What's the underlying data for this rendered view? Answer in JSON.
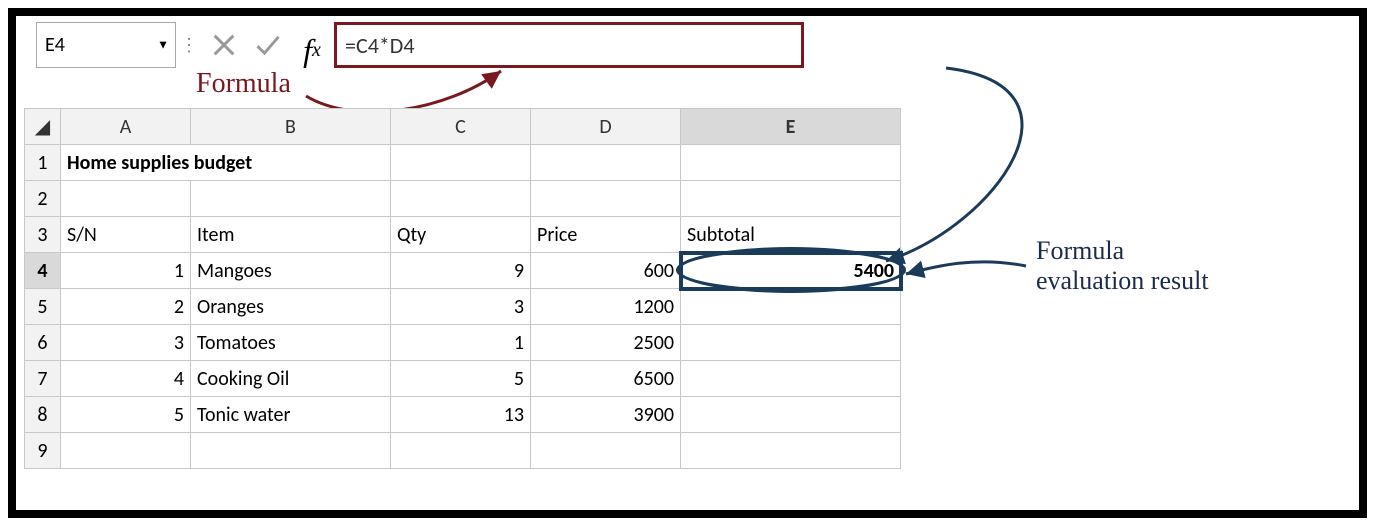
{
  "nameBox": "E4",
  "formula": "=C4*D4",
  "annotations": {
    "formula_label": "Formula",
    "result_label": "Formula\nevaluation result"
  },
  "columns": [
    "A",
    "B",
    "C",
    "D",
    "E"
  ],
  "row_numbers": [
    "1",
    "2",
    "3",
    "4",
    "5",
    "6",
    "7",
    "8",
    "9"
  ],
  "selected": {
    "col": "E",
    "row": "4"
  },
  "sheet": {
    "title": "Home supplies budget",
    "headers": {
      "sn": "S/N",
      "item": "Item",
      "qty": "Qty",
      "price": "Price",
      "subtotal": "Subtotal"
    },
    "rows": [
      {
        "sn": "1",
        "item": "Mangoes",
        "qty": "9",
        "price": "600",
        "subtotal": "5400"
      },
      {
        "sn": "2",
        "item": "Oranges",
        "qty": "3",
        "price": "1200",
        "subtotal": ""
      },
      {
        "sn": "3",
        "item": "Tomatoes",
        "qty": "1",
        "price": "2500",
        "subtotal": ""
      },
      {
        "sn": "4",
        "item": "Cooking Oil",
        "qty": "5",
        "price": "6500",
        "subtotal": ""
      },
      {
        "sn": "5",
        "item": "Tonic water",
        "qty": "13",
        "price": "3900",
        "subtotal": ""
      }
    ]
  },
  "chart_data": {
    "type": "table",
    "title": "Home supplies budget",
    "columns": [
      "S/N",
      "Item",
      "Qty",
      "Price",
      "Subtotal"
    ],
    "rows": [
      [
        1,
        "Mangoes",
        9,
        600,
        5400
      ],
      [
        2,
        "Oranges",
        3,
        1200,
        null
      ],
      [
        3,
        "Tomatoes",
        1,
        2500,
        null
      ],
      [
        4,
        "Cooking Oil",
        5,
        6500,
        null
      ],
      [
        5,
        "Tonic water",
        13,
        3900,
        null
      ]
    ]
  }
}
